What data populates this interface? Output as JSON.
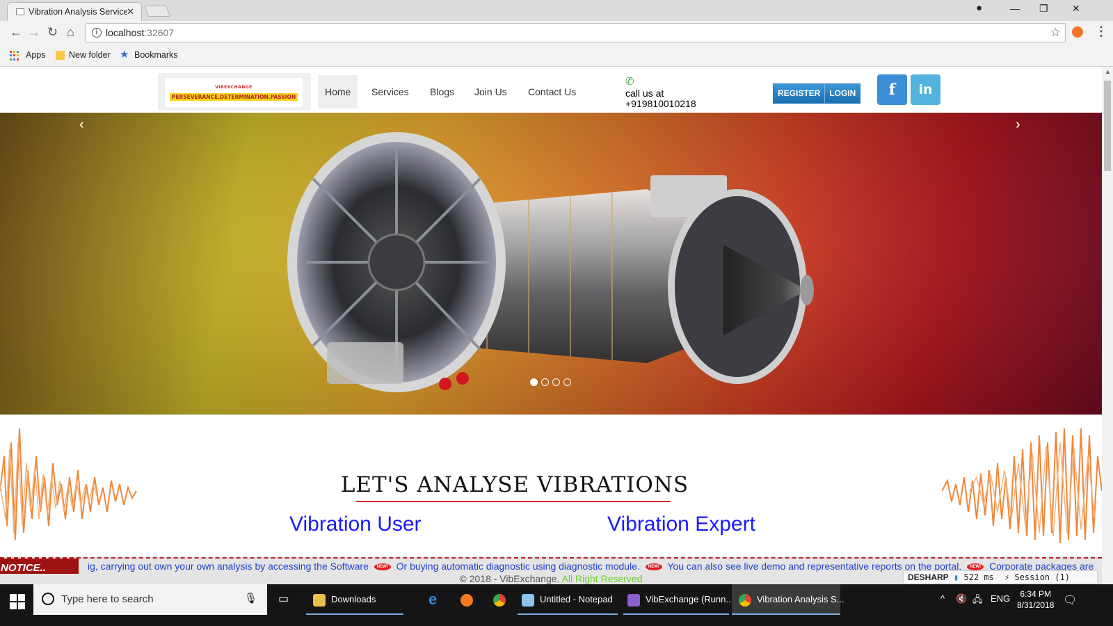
{
  "browser": {
    "tab_title": "Vibration Analysis Service",
    "url_host": "localhost",
    "url_port": ":32607",
    "bookmarks": [
      "Apps",
      "New folder",
      "Bookmarks"
    ]
  },
  "site": {
    "logo_top": "VIBEXCHANGE",
    "logo_bottom": "PERSEVERANCE.DETERMINATION.PASSION",
    "nav": [
      "Home",
      "Services",
      "Blogs",
      "Join Us",
      "Contact Us"
    ],
    "phone_label": "call us at",
    "phone_number": "+919810010218",
    "register": "REGISTER",
    "login": "LOGIN",
    "facebook": "f",
    "linkedin": "in"
  },
  "hero": {
    "prev": "‹",
    "next": "›",
    "slide_count": 4,
    "active_slide": 1
  },
  "content": {
    "heading": "LET'S ANALYSE VIBRATIONS",
    "col1": "Vibration User",
    "col2": "Vibration Expert"
  },
  "ticker": {
    "label": "NOTICE..",
    "items": [
      "ig, carrying out own your own analysis by accessing the Software",
      "Or buying automatic diagnostic using diagnostic module.",
      "You can also see live demo and representative reports on the portal.",
      "Corporate packages are"
    ],
    "badge": "NEW!"
  },
  "footer": {
    "copyright": "© 2018 - VibExchange.",
    "rights": "All Right Reserved"
  },
  "profiler": {
    "name": "DESHARP",
    "time": "522 ms",
    "session": "Session (1)"
  },
  "taskbar": {
    "search_placeholder": "Type here to search",
    "items": [
      "Downloads",
      "Untitled - Notepad",
      "VibExchange (Runn...",
      "Vibration Analysis S..."
    ],
    "lang": "ENG",
    "time": "6:34 PM",
    "date": "8/31/2018"
  },
  "colors": {
    "accent_blue": "#1a1aff",
    "notice_red": "#9f1212",
    "rule_red": "#d42a2a",
    "footer_green": "#6fce2f"
  }
}
